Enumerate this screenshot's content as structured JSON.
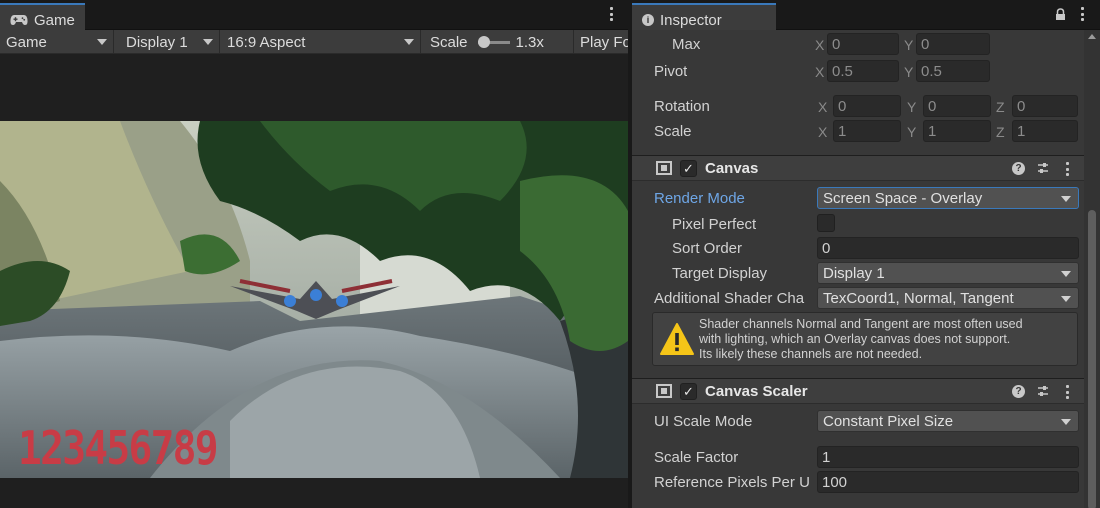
{
  "game": {
    "tab_label": "Game",
    "toolbar": {
      "mode": "Game",
      "display": "Display 1",
      "aspect": "16:9 Aspect",
      "scale_label": "Scale",
      "scale_value": "1.3x",
      "play_focused": "Play Fo"
    },
    "score_text": "123456789"
  },
  "inspector": {
    "tab_label": "Inspector",
    "transform": {
      "max": {
        "label": "Max",
        "x_axis": "X",
        "x": "0",
        "y_axis": "Y",
        "y": "0"
      },
      "pivot": {
        "label": "Pivot",
        "x_axis": "X",
        "x": "0.5",
        "y_axis": "Y",
        "y": "0.5"
      },
      "rotation": {
        "label": "Rotation",
        "x_axis": "X",
        "x": "0",
        "y_axis": "Y",
        "y": "0",
        "z_axis": "Z",
        "z": "0"
      },
      "scale": {
        "label": "Scale",
        "x_axis": "X",
        "x": "1",
        "y_axis": "Y",
        "y": "1",
        "z_axis": "Z",
        "z": "1"
      }
    },
    "canvas": {
      "title": "Canvas",
      "render_mode_label": "Render Mode",
      "render_mode_value": "Screen Space - Overlay",
      "pixel_perfect_label": "Pixel Perfect",
      "sort_order_label": "Sort Order",
      "sort_order_value": "0",
      "target_display_label": "Target Display",
      "target_display_value": "Display 1",
      "shader_channels_label": "Additional Shader Cha",
      "shader_channels_value": "TexCoord1, Normal, Tangent",
      "warning_line1": "Shader channels Normal and Tangent are most often used",
      "warning_line2": "with lighting, which an Overlay canvas does not support.",
      "warning_line3": "Its likely these channels are not needed."
    },
    "canvas_scaler": {
      "title": "Canvas Scaler",
      "ui_scale_mode_label": "UI Scale Mode",
      "ui_scale_mode_value": "Constant Pixel Size",
      "scale_factor_label": "Scale Factor",
      "scale_factor_value": "1",
      "ref_pixels_label": "Reference Pixels Per U",
      "ref_pixels_value": "100"
    }
  },
  "colors": {
    "accent": "#3a79bb",
    "label_highlight": "#6ea6e6",
    "score_red": "#c83c46",
    "warning_yellow": "#f5c518"
  }
}
